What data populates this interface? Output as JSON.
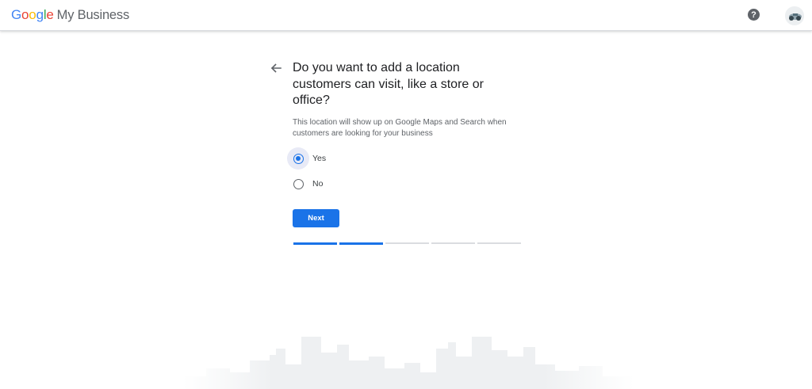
{
  "header": {
    "brand_google": "Google",
    "brand_product": "My Business",
    "help_glyph": "?",
    "colors": {
      "blue": "#4285F4",
      "red": "#EA4335",
      "yellow": "#FBBC05",
      "green": "#34A853"
    }
  },
  "question": {
    "title": "Do you want to add a location customers can visit, like a store or office?",
    "description": "This location will show up on Google Maps and Search when customers are looking for your business"
  },
  "options": [
    {
      "label": "Yes",
      "selected": true
    },
    {
      "label": "No",
      "selected": false
    }
  ],
  "next_label": "Next",
  "progress": {
    "steps_total": 5,
    "steps_done": 2
  },
  "accent_color": "#1a73e8"
}
